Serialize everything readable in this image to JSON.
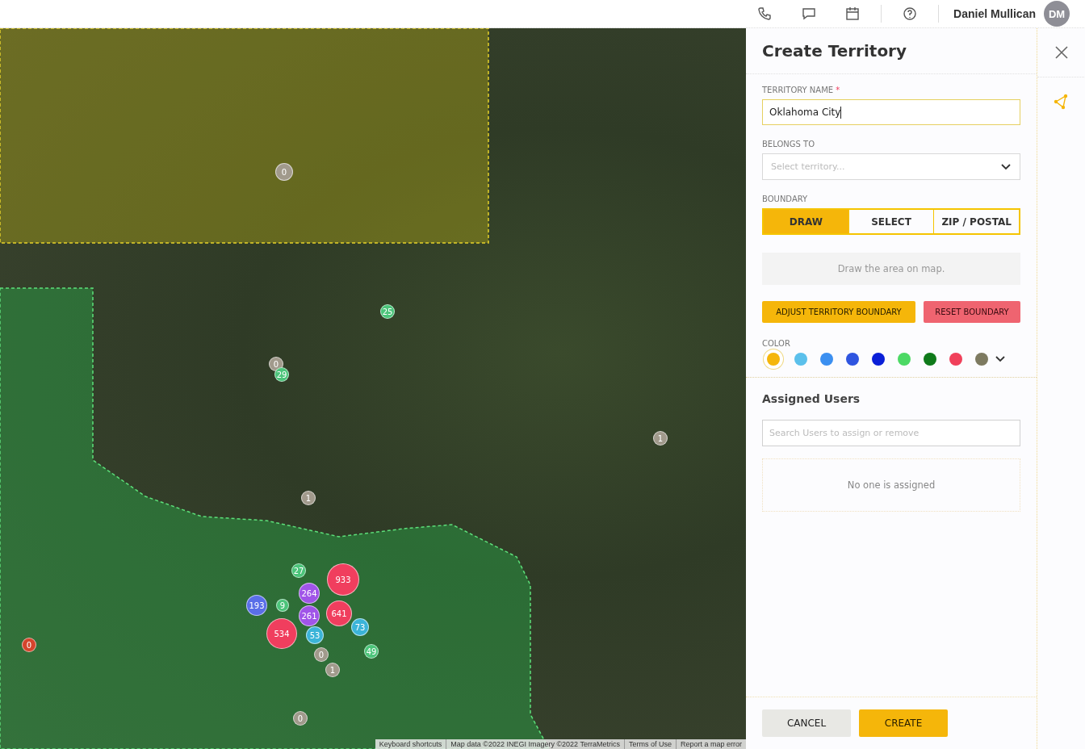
{
  "top_bar": {
    "user_name": "Daniel Mullican",
    "avatar_initials": "DM"
  },
  "map": {
    "markers": [
      {
        "count": "0",
        "color": "#a19a8c"
      },
      {
        "count": "25",
        "color": "#4cc47a"
      },
      {
        "count": "0",
        "color": "#a19a8c"
      },
      {
        "count": "29",
        "color": "#4cc47a"
      },
      {
        "count": "1",
        "color": "#a19a8c"
      },
      {
        "count": "1",
        "color": "#a19a8c"
      },
      {
        "count": "27",
        "color": "#4cc47a"
      },
      {
        "count": "933",
        "color": "#f03e5e"
      },
      {
        "count": "264",
        "color": "#a055e8"
      },
      {
        "count": "261",
        "color": "#a055e8"
      },
      {
        "count": "641",
        "color": "#f03e5e"
      },
      {
        "count": "193",
        "color": "#5a6ee8"
      },
      {
        "count": "9",
        "color": "#4cc47a"
      },
      {
        "count": "73",
        "color": "#3bb4d8"
      },
      {
        "count": "53",
        "color": "#3bb4d8"
      },
      {
        "count": "534",
        "color": "#f03e5e"
      },
      {
        "count": "0",
        "color": "#a19a8c"
      },
      {
        "count": "49",
        "color": "#4cc47a"
      },
      {
        "count": "1",
        "color": "#a19a8c"
      },
      {
        "count": "0",
        "color": "#d5442c"
      },
      {
        "count": "0",
        "color": "#a19a8c"
      }
    ],
    "attribution": [
      "Keyboard shortcuts",
      "Map data ©2022 INEGI Imagery ©2022 TerraMetrics",
      "Terms of Use",
      "Report a map error"
    ]
  },
  "panel": {
    "title": "Create Territory",
    "territory_name": {
      "label": "TERRITORY NAME",
      "required_mark": "*",
      "value": "Oklahoma City"
    },
    "belongs_to": {
      "label": "BELONGS TO",
      "placeholder": "Select territory..."
    },
    "boundary": {
      "label": "BOUNDARY",
      "options": [
        {
          "label": "DRAW",
          "selected": true
        },
        {
          "label": "SELECT",
          "selected": false
        },
        {
          "label": "ZIP / POSTAL",
          "selected": false
        }
      ]
    },
    "hint": "Draw the area on map.",
    "actions": [
      {
        "label": "ADJUST TERRITORY BOUNDARY",
        "kind": "primary"
      },
      {
        "label": "RESET BOUNDARY",
        "kind": "danger"
      }
    ],
    "color": {
      "label": "COLOR",
      "swatches": [
        {
          "color": "#f5b60a",
          "selected": true
        },
        {
          "color": "#5bc0eb",
          "selected": false
        },
        {
          "color": "#3b8ff0",
          "selected": false
        },
        {
          "color": "#2f55e0",
          "selected": false
        },
        {
          "color": "#0a1fd8",
          "selected": false
        },
        {
          "color": "#4cd964",
          "selected": false
        },
        {
          "color": "#0f7a1a",
          "selected": false
        },
        {
          "color": "#f0405a",
          "selected": false
        },
        {
          "color": "#7d7a60",
          "selected": false
        }
      ]
    }
  },
  "assigned_users": {
    "title": "Assigned Users",
    "search": {
      "placeholder": "Search Users to assign or remove"
    },
    "empty_message": "No one is assigned"
  },
  "footer": {
    "buttons": [
      {
        "label": "CANCEL",
        "kind": "secondary"
      },
      {
        "label": "CREATE",
        "kind": "primary"
      }
    ]
  }
}
